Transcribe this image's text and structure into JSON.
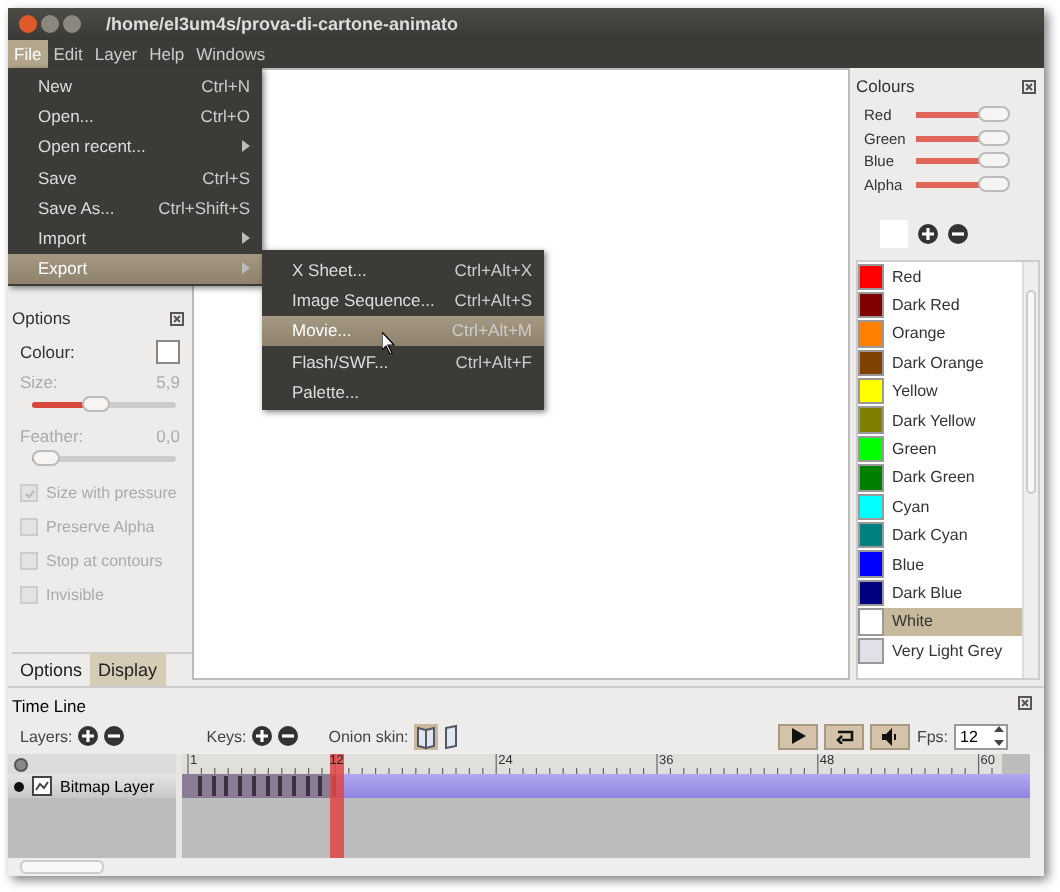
{
  "window": {
    "title": "/home/el3um4s/prova-di-cartone-animato"
  },
  "menubar": [
    {
      "label": "File",
      "selected": true
    },
    {
      "label": "Edit",
      "selected": false
    },
    {
      "label": "Layer",
      "selected": false
    },
    {
      "label": "Help",
      "selected": false
    },
    {
      "label": "Windows",
      "selected": false
    }
  ],
  "file_menu": [
    {
      "label": "New",
      "shortcut": "Ctrl+N",
      "kind": "item",
      "selected": false
    },
    {
      "label": "Open...",
      "shortcut": "Ctrl+O",
      "kind": "item",
      "selected": false
    },
    {
      "label": "Open recent...",
      "kind": "submenu",
      "selected": false
    },
    {
      "label": "Save",
      "shortcut": "Ctrl+S",
      "kind": "item",
      "selected": false
    },
    {
      "label": "Save As...",
      "shortcut": "Ctrl+Shift+S",
      "kind": "item",
      "selected": false
    },
    {
      "label": "Import",
      "kind": "submenu",
      "selected": false
    },
    {
      "label": "Export",
      "kind": "submenu",
      "selected": true
    }
  ],
  "export_menu": [
    {
      "label": "X Sheet...",
      "shortcut": "Ctrl+Alt+X",
      "selected": false
    },
    {
      "label": "Image Sequence...",
      "shortcut": "Ctrl+Alt+S",
      "selected": false
    },
    {
      "label": "Movie...",
      "shortcut": "Ctrl+Alt+M",
      "selected": true
    },
    {
      "label": "Flash/SWF...",
      "shortcut": "Ctrl+Alt+F",
      "selected": false
    },
    {
      "label": "Palette...",
      "selected": false
    }
  ],
  "options_panel": {
    "title": "Options",
    "colour_label": "Colour:",
    "size": {
      "label": "Size:",
      "reading": "5,9",
      "level": 0.45
    },
    "feather": {
      "label": "Feather:",
      "reading": "0,0",
      "level": 0.1
    },
    "checkboxes": [
      {
        "label": "Size with pressure",
        "checked": true,
        "disabled": true
      },
      {
        "label": "Preserve Alpha",
        "checked": false,
        "disabled": true
      },
      {
        "label": "Stop at contours",
        "checked": false,
        "disabled": true
      },
      {
        "label": "Invisible",
        "checked": false,
        "disabled": true
      }
    ],
    "tabs": [
      {
        "label": "Options",
        "selected": true
      },
      {
        "label": "Display",
        "selected": false
      }
    ]
  },
  "colours_panel": {
    "title": "Colours",
    "sliders": [
      {
        "label": "Red",
        "level": 0.85
      },
      {
        "label": "Green",
        "level": 0.85
      },
      {
        "label": "Blue",
        "level": 0.85
      },
      {
        "label": "Alpha",
        "level": 0.85
      }
    ],
    "swatches": [
      {
        "name": "Red",
        "color": "#ff0000",
        "selected": false
      },
      {
        "name": "Dark Red",
        "color": "#800000",
        "selected": false
      },
      {
        "name": "Orange",
        "color": "#ff8000",
        "selected": false
      },
      {
        "name": "Dark Orange",
        "color": "#804000",
        "selected": false
      },
      {
        "name": "Yellow",
        "color": "#ffff00",
        "selected": false
      },
      {
        "name": "Dark Yellow",
        "color": "#808000",
        "selected": false
      },
      {
        "name": "Green",
        "color": "#00ff00",
        "selected": false
      },
      {
        "name": "Dark Green",
        "color": "#008000",
        "selected": false
      },
      {
        "name": "Cyan",
        "color": "#00ffff",
        "selected": false
      },
      {
        "name": "Dark Cyan",
        "color": "#008080",
        "selected": false
      },
      {
        "name": "Blue",
        "color": "#0000ff",
        "selected": false
      },
      {
        "name": "Dark Blue",
        "color": "#000080",
        "selected": false
      },
      {
        "name": "White",
        "color": "#ffffff",
        "selected": true
      },
      {
        "name": "Very Light Grey",
        "color": "#e0e0e8",
        "selected": false
      }
    ]
  },
  "timeline": {
    "title": "Time Line",
    "layers_label": "Layers:",
    "keys_label": "Keys:",
    "onion_skin_label": "Onion skin:",
    "fps_label": "Fps:",
    "fps": "12",
    "ruler_labels": [
      "1",
      "24",
      "36",
      "48",
      "60"
    ],
    "playhead": "12",
    "layers": [
      {
        "name": "Bitmap Layer",
        "kind": "bitmap"
      }
    ]
  }
}
